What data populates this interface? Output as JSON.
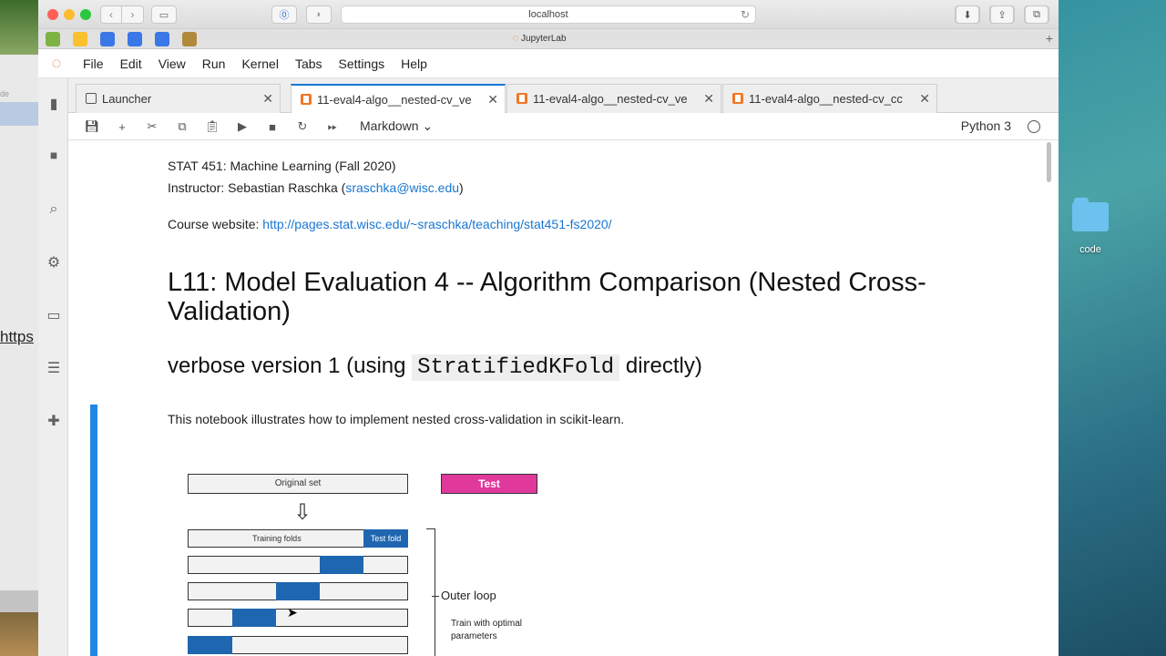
{
  "desktop": {
    "folder_label": "code",
    "left_partial_text": "https",
    "left_partial_small": "de"
  },
  "browser": {
    "url": "localhost",
    "page_title": "JupyterLab"
  },
  "menu": [
    "File",
    "Edit",
    "View",
    "Run",
    "Kernel",
    "Tabs",
    "Settings",
    "Help"
  ],
  "tabs": [
    {
      "label": "Launcher",
      "active": false
    },
    {
      "label": "11-eval4-algo__nested-cv_ve",
      "active": true
    },
    {
      "label": "11-eval4-algo__nested-cv_ve",
      "active": false
    },
    {
      "label": "11-eval4-algo__nested-cv_cc",
      "active": false
    }
  ],
  "toolbar": {
    "cell_type": "Markdown",
    "kernel": "Python 3"
  },
  "notebook": {
    "course_line": "STAT 451: Machine Learning (Fall 2020)",
    "instructor_prefix": "Instructor: Sebastian Raschka (",
    "instructor_email": "sraschka@wisc.edu",
    "instructor_suffix": ")",
    "website_prefix": "Course website: ",
    "website_url": "http://pages.stat.wisc.edu/~sraschka/teaching/stat451-fs2020/",
    "heading1": "L11: Model Evaluation 4 -- Algorithm Comparison (Nested Cross-Validation)",
    "heading2_prefix": "verbose version 1 (using ",
    "heading2_code": "StratifiedKFold",
    "heading2_suffix": " directly)",
    "paragraph": "This notebook illustrates how to implement nested cross-validation in scikit-learn."
  },
  "diagram": {
    "original_set": "Original set",
    "test": "Test",
    "training_folds": "Training folds",
    "test_fold": "Test fold",
    "outer_loop": "Outer loop",
    "train_optimal_line1": "Train with optimal",
    "train_optimal_line2": "parameters"
  },
  "colors": {
    "accent": "#1976d2",
    "jupyter_orange": "#f37626",
    "fold_blue": "#1f66b0",
    "test_pink": "#e0399b"
  }
}
